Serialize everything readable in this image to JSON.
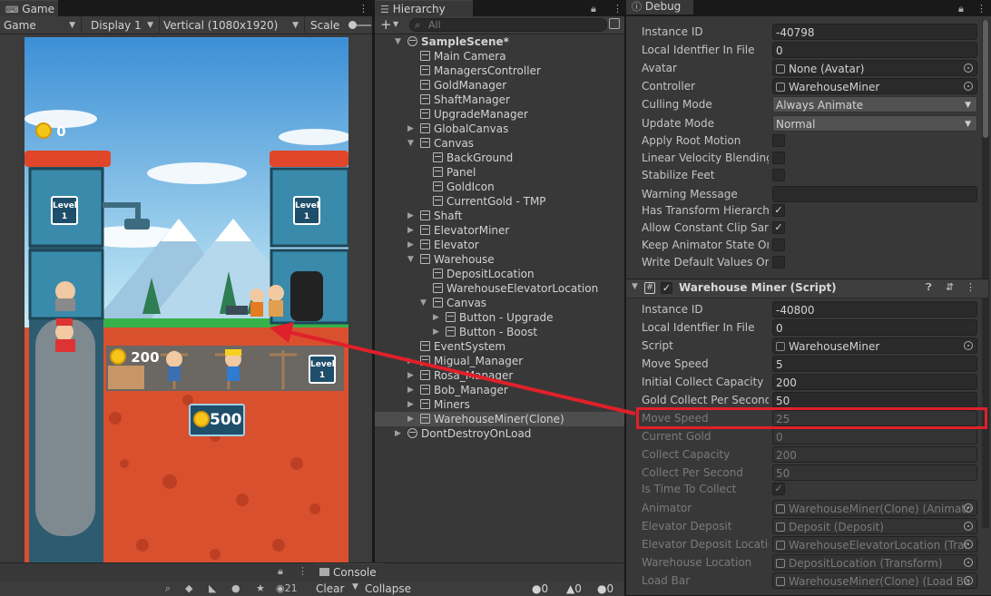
{
  "game_panel": {
    "tab_title": "Game",
    "toolbar": {
      "mode": "Game",
      "display": "Display 1",
      "resolution": "Vertical (1080x1920)",
      "scale_label": "Scale"
    },
    "hud": {
      "gold_count": "0",
      "warehouse_amount": "200",
      "shaft_amount": "500",
      "level_left": "Level",
      "level_left_num": "1",
      "level_right": "Level",
      "level_right_num": "1",
      "level_shaft": "Level",
      "level_shaft_num": "1"
    }
  },
  "console_panel": {
    "tab_title": "Console",
    "clear_label": "Clear",
    "collapse_label": "Collapse",
    "counts": {
      "log": "0",
      "warn": "0",
      "error": "0"
    },
    "messages_count": "21"
  },
  "hierarchy": {
    "tab_title": "Hierarchy",
    "search_placeholder": "All",
    "items": [
      {
        "label": "SampleScene*",
        "depth": 0,
        "fold": "open",
        "icon": "unity-scene-icon",
        "bold": true
      },
      {
        "label": "Main Camera",
        "depth": 1,
        "fold": "none"
      },
      {
        "label": "ManagersController",
        "depth": 1,
        "fold": "none"
      },
      {
        "label": "GoldManager",
        "depth": 1,
        "fold": "none"
      },
      {
        "label": "ShaftManager",
        "depth": 1,
        "fold": "none"
      },
      {
        "label": "UpgradeManager",
        "depth": 1,
        "fold": "none"
      },
      {
        "label": "GlobalCanvas",
        "depth": 1,
        "fold": "closed"
      },
      {
        "label": "Canvas",
        "depth": 1,
        "fold": "open"
      },
      {
        "label": "BackGround",
        "depth": 2,
        "fold": "none"
      },
      {
        "label": "Panel",
        "depth": 2,
        "fold": "none"
      },
      {
        "label": "GoldIcon",
        "depth": 2,
        "fold": "none"
      },
      {
        "label": "CurrentGold - TMP",
        "depth": 2,
        "fold": "none"
      },
      {
        "label": "Shaft",
        "depth": 1,
        "fold": "closed"
      },
      {
        "label": "ElevatorMiner",
        "depth": 1,
        "fold": "closed"
      },
      {
        "label": "Elevator",
        "depth": 1,
        "fold": "closed"
      },
      {
        "label": "Warehouse",
        "depth": 1,
        "fold": "open"
      },
      {
        "label": "DepositLocation",
        "depth": 2,
        "fold": "none"
      },
      {
        "label": "WarehouseElevatorLocation",
        "depth": 2,
        "fold": "none"
      },
      {
        "label": "Canvas",
        "depth": 2,
        "fold": "open"
      },
      {
        "label": "Button - Upgrade",
        "depth": 3,
        "fold": "closed"
      },
      {
        "label": "Button - Boost",
        "depth": 3,
        "fold": "closed"
      },
      {
        "label": "EventSystem",
        "depth": 1,
        "fold": "none"
      },
      {
        "label": "Migual_Manager",
        "depth": 1,
        "fold": "closed"
      },
      {
        "label": "Rosa_Manager",
        "depth": 1,
        "fold": "closed"
      },
      {
        "label": "Bob_Manager",
        "depth": 1,
        "fold": "closed"
      },
      {
        "label": "Miners",
        "depth": 1,
        "fold": "closed"
      },
      {
        "label": "WarehouseMiner(Clone)",
        "depth": 1,
        "fold": "closed",
        "selected": true
      },
      {
        "label": "DontDestroyOnLoad",
        "depth": 0,
        "fold": "closed",
        "icon": "unity-scene-icon"
      }
    ]
  },
  "inspector": {
    "tab_title": "Debug",
    "animator_fields": [
      {
        "label": "Instance ID",
        "value": "-40798",
        "kind": "text"
      },
      {
        "label": "Local Identfier In File",
        "value": "0",
        "kind": "text"
      },
      {
        "label": "Avatar",
        "value": "None (Avatar)",
        "kind": "object",
        "icon": "avatar-icon"
      },
      {
        "label": "Controller",
        "value": "WarehouseMiner",
        "kind": "object",
        "icon": "animator-controller-icon"
      },
      {
        "label": "Culling Mode",
        "value": "Always Animate",
        "kind": "dropdown"
      },
      {
        "label": "Update Mode",
        "value": "Normal",
        "kind": "dropdown"
      },
      {
        "label": "Apply Root Motion",
        "value": "",
        "kind": "check",
        "checked": false
      },
      {
        "label": "Linear Velocity Blending",
        "value": "",
        "kind": "check",
        "checked": false
      },
      {
        "label": "Stabilize Feet",
        "value": "",
        "kind": "check",
        "checked": false
      },
      {
        "label": "Warning Message",
        "value": "",
        "kind": "text"
      },
      {
        "label": "Has Transform Hierarchy",
        "value": "",
        "kind": "check",
        "checked": true
      },
      {
        "label": "Allow Constant Clip Samp",
        "value": "",
        "kind": "check",
        "checked": true
      },
      {
        "label": "Keep Animator State On D",
        "value": "",
        "kind": "check",
        "checked": false
      },
      {
        "label": "Write Default Values On D",
        "value": "",
        "kind": "check",
        "checked": false
      }
    ],
    "script_header": "Warehouse Miner (Script)",
    "script_fields": [
      {
        "label": "Instance ID",
        "value": "-40800",
        "kind": "text"
      },
      {
        "label": "Local Identfier In File",
        "value": "0",
        "kind": "text"
      },
      {
        "label": "Script",
        "value": "WarehouseMiner",
        "kind": "object",
        "icon": "script-icon"
      },
      {
        "label": "Move Speed",
        "value": "5",
        "kind": "text"
      },
      {
        "label": "Initial Collect Capacity",
        "value": "200",
        "kind": "text"
      },
      {
        "label": "Gold Collect Per Second",
        "value": "50",
        "kind": "text"
      },
      {
        "label": "Move Speed",
        "value": "25",
        "kind": "text",
        "disabled": true,
        "highlight": true
      },
      {
        "label": "Current Gold",
        "value": "0",
        "kind": "text",
        "disabled": true
      },
      {
        "label": "Collect Capacity",
        "value": "200",
        "kind": "text",
        "disabled": true
      },
      {
        "label": "Collect Per Second",
        "value": "50",
        "kind": "text",
        "disabled": true
      },
      {
        "label": "Is Time To Collect",
        "value": "",
        "kind": "check",
        "checked": true,
        "disabled": true
      },
      {
        "label": "Animator",
        "value": "WarehouseMiner(Clone) (Animato",
        "kind": "object",
        "disabled": true,
        "icon": "animator-icon"
      },
      {
        "label": "Elevator Deposit",
        "value": "Deposit (Deposit)",
        "kind": "object",
        "disabled": true,
        "icon": "script-icon"
      },
      {
        "label": "Elevator Deposit Location",
        "value": "WarehouseElevatorLocation (Trar",
        "kind": "object",
        "disabled": true,
        "icon": "transform-icon"
      },
      {
        "label": "Warehouse Location",
        "value": "DepositLocation (Transform)",
        "kind": "object",
        "disabled": true,
        "icon": "transform-icon"
      },
      {
        "label": "Load Bar",
        "value": "WarehouseMiner(Clone) (Load Ba",
        "kind": "object",
        "disabled": true,
        "icon": "script-icon"
      }
    ]
  },
  "colors": {
    "highlight_box": "#e0202a",
    "annotation_arrow": "#e0202a",
    "selected_row": "#4d4d4d",
    "panel_bg": "#383838"
  }
}
